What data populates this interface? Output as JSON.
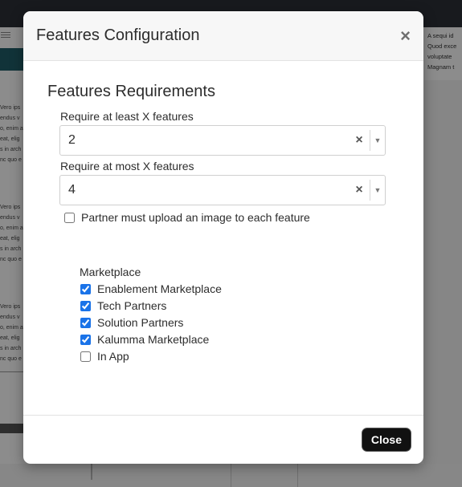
{
  "background": {
    "left_snippets_1": [
      "Vero ips",
      "endus v",
      "o, enim a",
      "eat, elig",
      "s in arch",
      "nc quo e"
    ],
    "left_snippets_2": [
      "Vero ips",
      "endus v",
      "o, enim a",
      "eat, elig",
      "s in arch",
      "nc quo e"
    ],
    "left_snippets_3": [
      "Vero ips",
      "endus v",
      "o, enim a",
      "eat, elig",
      "s in arch",
      "nc quo e"
    ],
    "right_snippets": [
      "A sequi id",
      "Quod exce",
      "voluptate",
      "Magnam t"
    ]
  },
  "modal": {
    "title": "Features Configuration",
    "close_icon": "×",
    "section_title": "Features Requirements",
    "min_label": "Require at least X features",
    "min_value": "2",
    "max_label": "Require at most X features",
    "max_value": "4",
    "clear_icon": "×",
    "dropdown_icon": "▼",
    "image_checkbox_label": "Partner must upload an image to each feature",
    "image_checkbox_checked": false,
    "marketplace_label": "Marketplace",
    "marketplaces": [
      {
        "label": "Enablement Marketplace",
        "checked": true
      },
      {
        "label": "Tech Partners",
        "checked": true
      },
      {
        "label": "Solution Partners",
        "checked": true
      },
      {
        "label": "Kalumma Marketplace",
        "checked": true
      },
      {
        "label": "In App",
        "checked": false
      }
    ],
    "close_button": "Close"
  },
  "colors": {
    "overlay": "#000000",
    "accent_checkbox": "#1a73e8",
    "close_button_bg": "#111111"
  }
}
